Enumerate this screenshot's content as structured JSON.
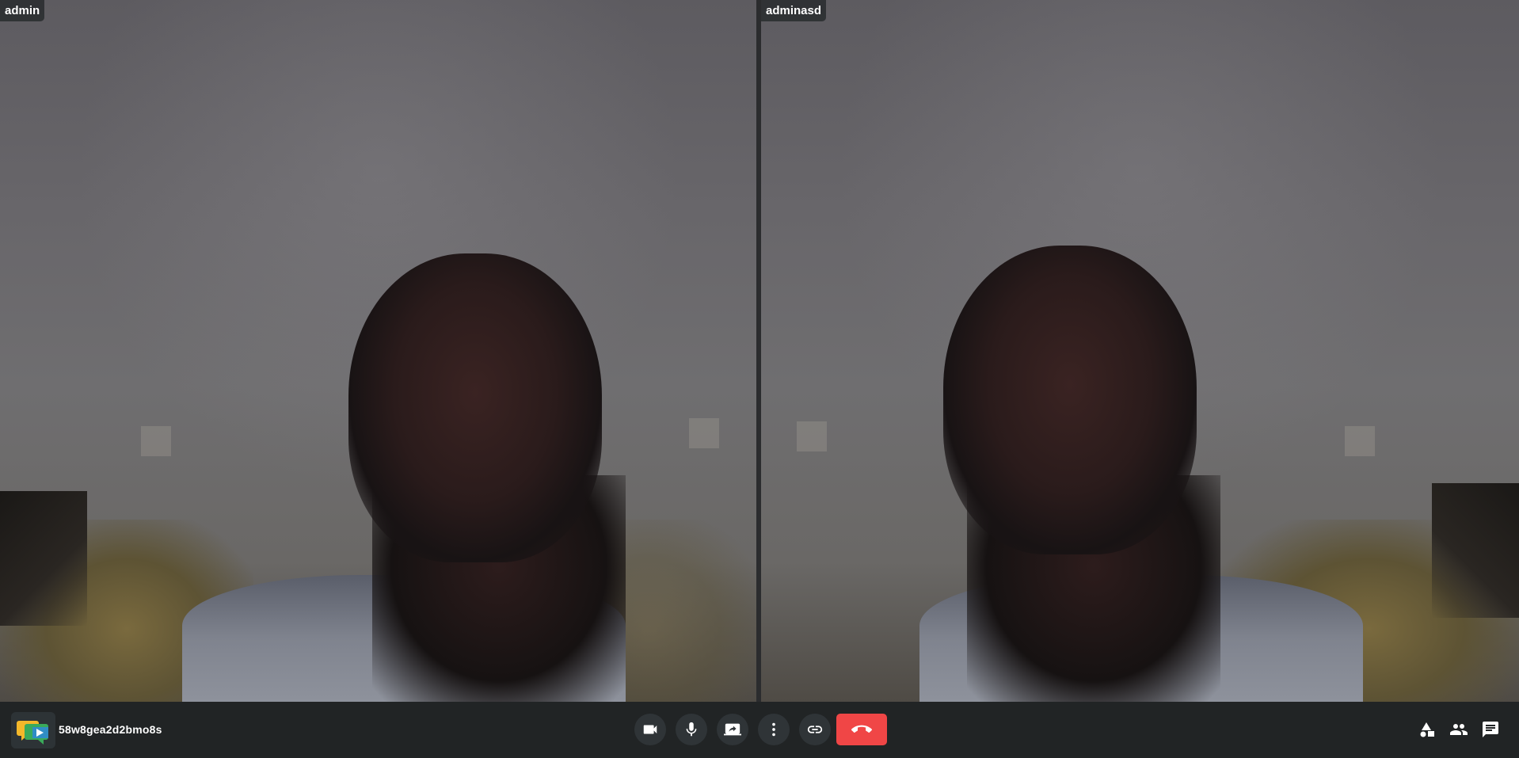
{
  "participants": [
    {
      "name": "admin"
    },
    {
      "name": "adminasd"
    }
  ],
  "toolbar": {
    "meeting_id": "58w8gea2d2bmo8s",
    "controls": [
      {
        "icon": "video-camera-icon"
      },
      {
        "icon": "microphone-icon"
      },
      {
        "icon": "screen-share-icon"
      },
      {
        "icon": "more-options-icon"
      },
      {
        "icon": "invite-link-icon"
      }
    ],
    "end_call_icon": "hang-up-icon",
    "right_actions": [
      {
        "icon": "whiteboard-shapes-icon"
      },
      {
        "icon": "participants-icon"
      },
      {
        "icon": "chat-icon"
      }
    ]
  },
  "colors": {
    "toolbar_bg": "#212425",
    "control_bg": "#2f3437",
    "end_call": "#f04646",
    "name_tag_bg": "#282c2e"
  }
}
